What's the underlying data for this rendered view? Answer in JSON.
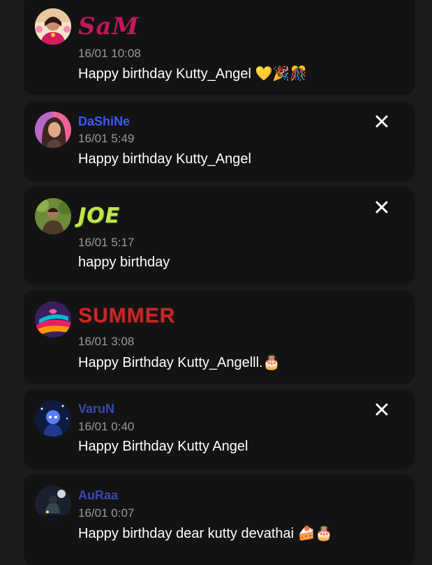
{
  "comments": [
    {
      "name": "SaM",
      "time": "16/01 10:08",
      "message": "Happy birthday Kutty_Angel 💛🎉🎊",
      "avatar_icon": "avatar-woman-traditional",
      "name_color": "#c2185b",
      "deletable": false
    },
    {
      "name": "DaShiNe",
      "time": "16/01 5:49",
      "message": "Happy birthday Kutty_Angel",
      "avatar_icon": "avatar-woman-portrait",
      "name_color": "#3d5afe",
      "deletable": true
    },
    {
      "name": "JOE",
      "time": "16/01 5:17",
      "message": "happy birthday",
      "avatar_icon": "avatar-man-outdoor",
      "name_color": "#c6e34a",
      "deletable": true
    },
    {
      "name": "SUMMER",
      "time": "16/01 3:08",
      "message": "Happy Birthday Kutty_Angelll.🎂",
      "avatar_icon": "avatar-colorful-art",
      "name_color": "#c62828",
      "deletable": false
    },
    {
      "name": "VaruN",
      "time": "16/01 0:40",
      "message": "Happy Birthday Kutty Angel",
      "avatar_icon": "avatar-blue-cartoon",
      "name_color": "#3949ab",
      "deletable": true
    },
    {
      "name": "AuRaa",
      "time": "16/01 0:07",
      "message": "Happy birthday dear kutty devathai 🍰🎂",
      "avatar_icon": "avatar-night-scene",
      "name_color": "#3949ab",
      "deletable": false
    }
  ],
  "icons": {
    "close": "close-icon"
  }
}
